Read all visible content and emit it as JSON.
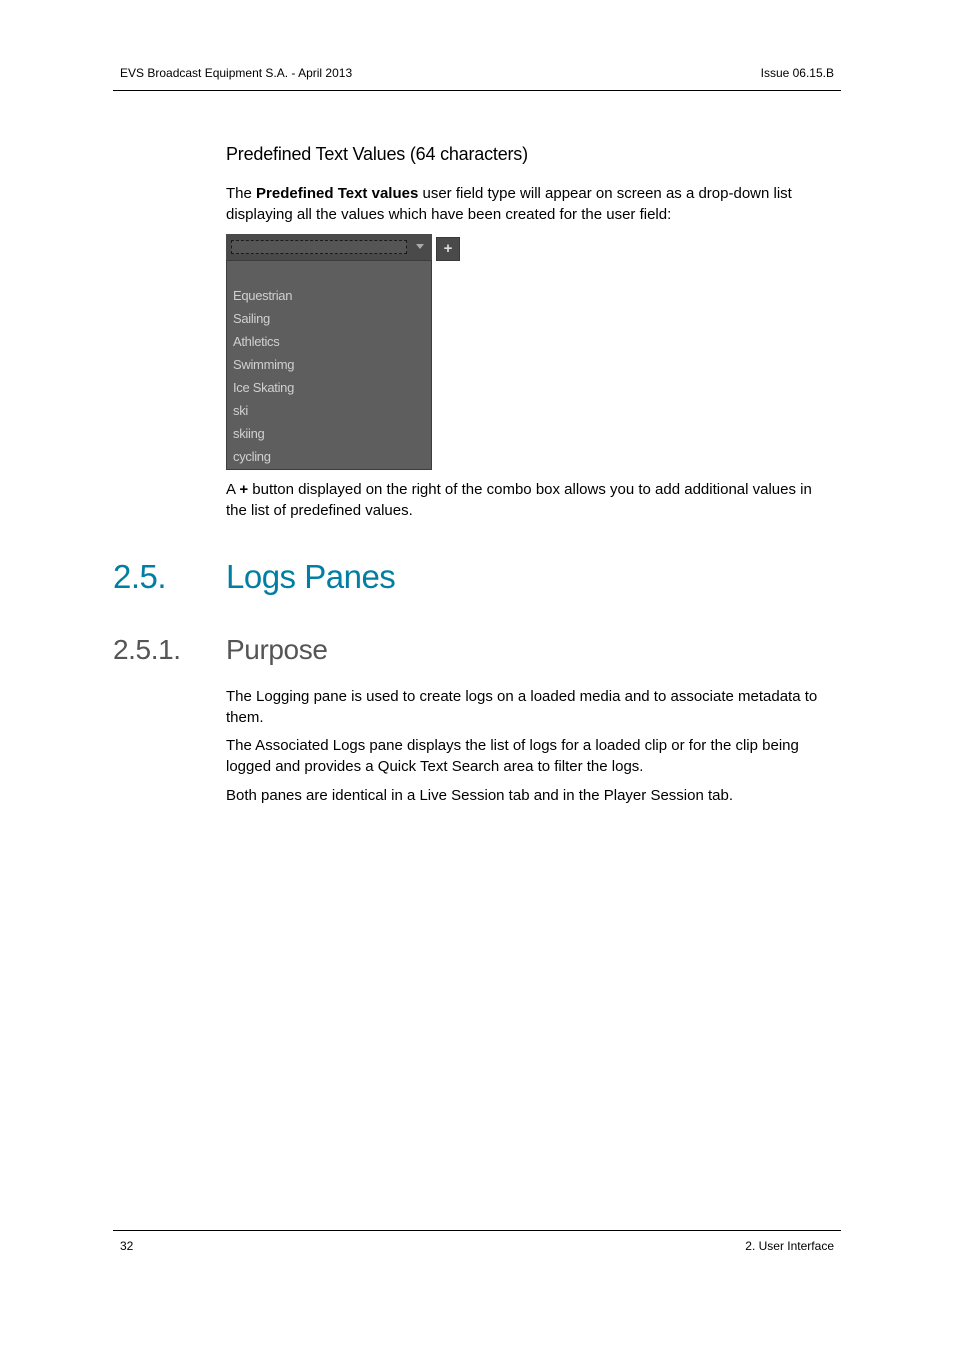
{
  "header": {
    "left": "EVS Broadcast Equipment S.A.  - April 2013",
    "right": "Issue 06.15.B"
  },
  "section_predefined": {
    "title": "Predefined Text Values (64 characters)",
    "intro_prefix": "The ",
    "intro_bold": "Predefined Text values",
    "intro_suffix": " user field type will appear on screen as a drop-down list displaying all the values which have been created for the user field:",
    "combo": {
      "current_value": "",
      "add_button_label": "+",
      "options": [
        "",
        "Equestrian",
        "Sailing",
        "Athletics",
        "Swimmimg",
        "Ice Skating",
        "ski",
        "skiing",
        "cycling"
      ]
    },
    "after_prefix": "A ",
    "after_bold": "+",
    "after_suffix": " button displayed on the right of the combo box allows you to add additional values in the list of predefined values."
  },
  "section_logs": {
    "number": "2.5.",
    "title": "Logs Panes",
    "color": "#007fa3"
  },
  "section_purpose": {
    "number": "2.5.1.",
    "title": "Purpose",
    "paragraphs": [
      "The Logging pane is used to create logs on a loaded media and to associate metadata to them.",
      "The Associated Logs pane displays the list of logs for a loaded clip or for the clip being logged and provides a Quick Text Search area to filter the logs.",
      "Both panes are identical in a Live Session tab and in the Player Session tab."
    ]
  },
  "footer": {
    "page_number": "32",
    "chapter": "2. User Interface"
  }
}
